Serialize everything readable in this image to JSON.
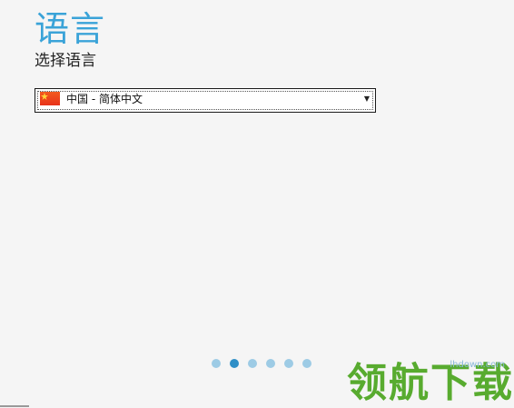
{
  "page": {
    "title": "语言",
    "subtitle": "选择语言"
  },
  "language_select": {
    "selected_value": "中国 - 简体中文",
    "flag_icon": "china-flag-icon",
    "arrow_icon": "dropdown-arrow-icon"
  },
  "pager": {
    "total": 6,
    "current": 2
  },
  "watermark": {
    "text": "领航下载",
    "url": "lhdown.com"
  },
  "colors": {
    "accent": "#3aa3d8",
    "dot_active": "#2f8fc7",
    "dot_inactive": "#9dcbe5",
    "watermark": "#58ab2f"
  }
}
